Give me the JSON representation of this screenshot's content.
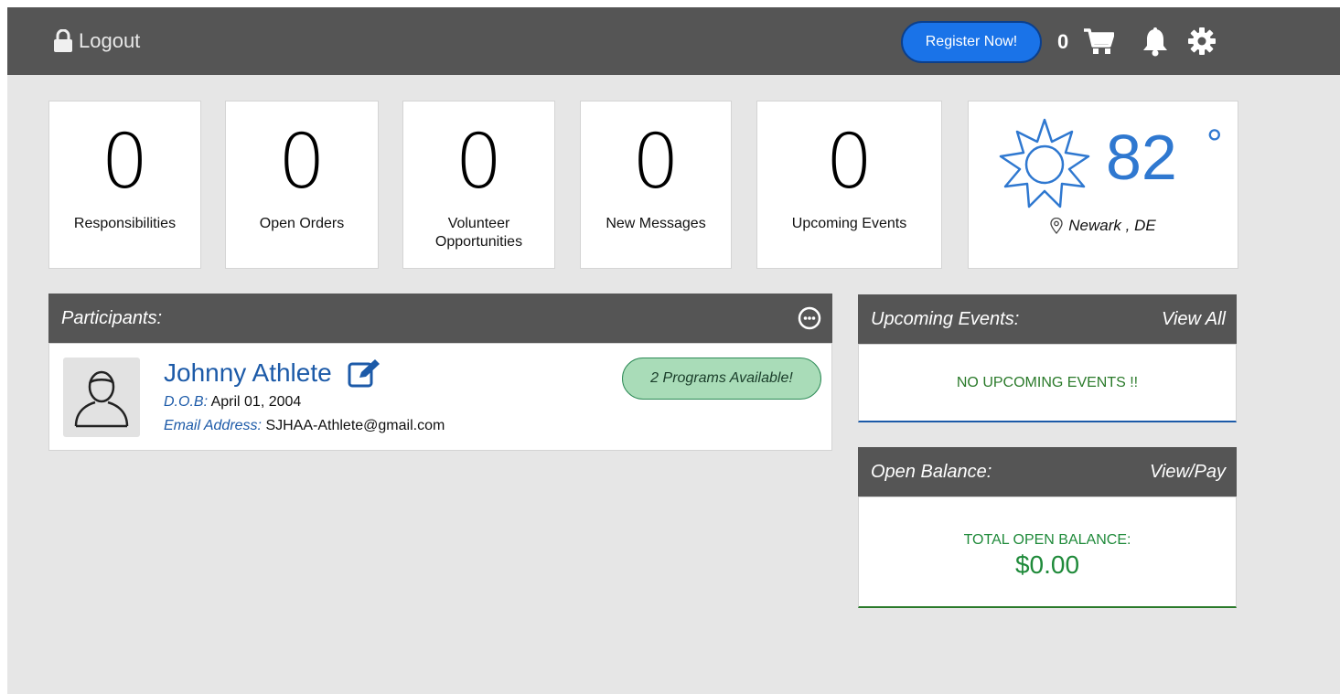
{
  "topbar": {
    "logout_label": "Logout",
    "register_label": "Register Now!",
    "cart_count": "0",
    "colors": {
      "bar": "#555555",
      "register": "#1a73e8"
    },
    "icons": [
      "lock-icon",
      "cart-icon",
      "bell-icon",
      "gear-icon"
    ]
  },
  "tiles": [
    {
      "count": "0",
      "label": "Responsibilities"
    },
    {
      "count": "0",
      "label": "Open Orders"
    },
    {
      "count": "0",
      "label": "Volunteer Opportunities"
    },
    {
      "count": "0",
      "label": "New Messages"
    },
    {
      "count": "0",
      "label": "Upcoming Events"
    }
  ],
  "weather": {
    "temperature": "82",
    "degree_symbol": "°",
    "location": "Newark , DE",
    "icons": [
      "sun-icon",
      "map-pin-icon"
    ],
    "accent": "#2f78d0"
  },
  "participants": {
    "title": "Participants:",
    "items": [
      {
        "name": "Johnny Athlete",
        "dob_label": "D.O.B:",
        "dob": "April 01, 2004",
        "email_label": "Email Address:",
        "email": "SJHAA-Athlete@gmail.com",
        "programs_badge": "2 Programs Available!"
      }
    ]
  },
  "upcoming_events": {
    "title": "Upcoming Events:",
    "link": "View All",
    "empty_text": "NO UPCOMING EVENTS !!"
  },
  "open_balance": {
    "title": "Open Balance:",
    "link": "View/Pay",
    "label": "TOTAL OPEN BALANCE:",
    "amount": "$0.00",
    "accent": "#1f8a3a"
  }
}
